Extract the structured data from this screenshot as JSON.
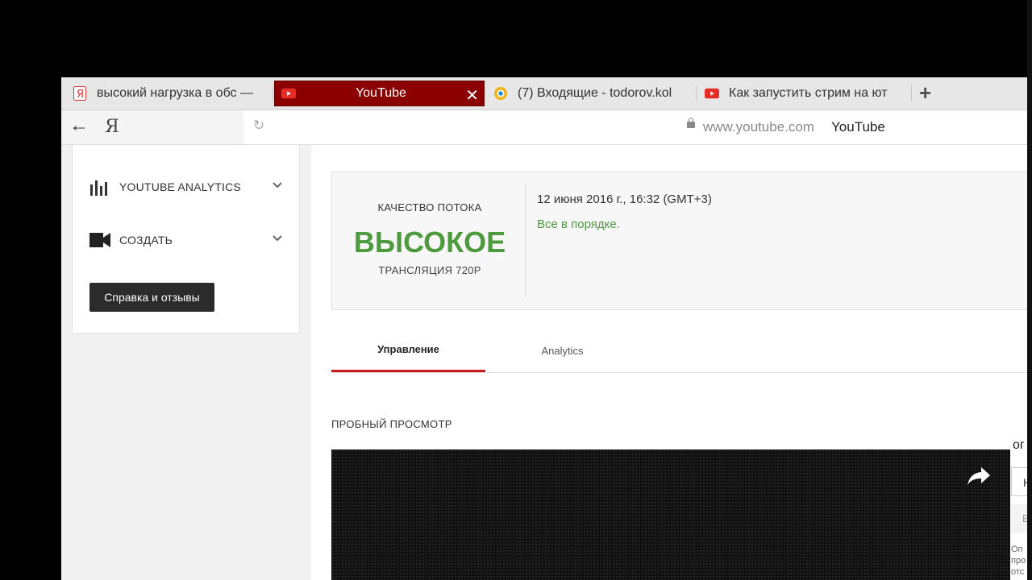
{
  "browser": {
    "tabs": [
      {
        "label": "высокий нагрузка в обс —",
        "icon": "yandex-icon"
      },
      {
        "label": "YouTube",
        "icon": "youtube-icon",
        "active": true
      },
      {
        "label": "(7) Входящие - todorov.kol",
        "icon": "mail-icon"
      },
      {
        "label": "Как запустить стрим на ют",
        "icon": "youtube-icon"
      }
    ],
    "logo": "Я",
    "url": "www.youtube.com",
    "page_title": "YouTube"
  },
  "sidebar": {
    "items": [
      {
        "label": "YOUTUBE ANALYTICS",
        "icon": "bar-chart-icon"
      },
      {
        "label": "СОЗДАТЬ",
        "icon": "video-camera-icon"
      }
    ],
    "help_button": "Справка и отзывы"
  },
  "stream": {
    "quality_heading": "КАЧЕСТВО ПОТОКА",
    "quality_value": "ВЫСОКОЕ",
    "quality_sub": "ТРАНСЛЯЦИЯ 720P",
    "timestamp": "12 июня 2016 г., 16:32 (GMT+3)",
    "status": "Все в порядке."
  },
  "tabs": [
    {
      "label": "Управление",
      "active": true
    },
    {
      "label": "Analytics",
      "active": false
    }
  ],
  "preview": {
    "title": "ПРОБНЫЙ ПРОСМОТР"
  },
  "right_panel": {
    "heading_fragment": "ог",
    "field_fragment": "Н",
    "field2_fragment": "В",
    "text_fragment_1": "Оп",
    "text_fragment_2": "про",
    "text_fragment_3": "отс"
  },
  "colors": {
    "active_tab": "#8b0000",
    "quality_green": "#4e9a3f",
    "tab_underline": "#cc181e"
  }
}
